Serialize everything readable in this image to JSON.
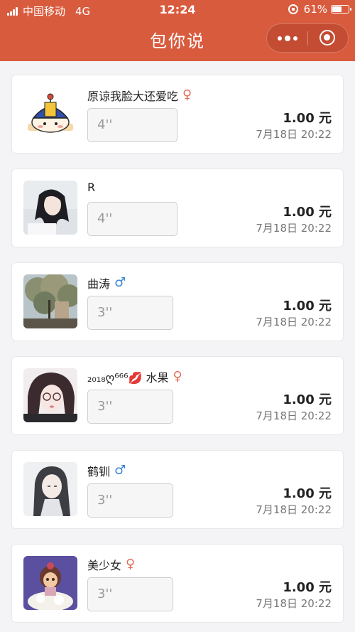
{
  "status_bar": {
    "carrier": "中国移动",
    "network": "4G",
    "time": "12:24",
    "battery": "61%",
    "battery_level": 0.61
  },
  "nav": {
    "title": "包你说"
  },
  "colors": {
    "header_bg": "#d95b3e",
    "female": "#e36e59",
    "male": "#3a87d9"
  },
  "items": [
    {
      "nickname": "原谅我脸大还爱吃",
      "gender": "♀",
      "avatar": "cartoon-hat-avatar",
      "voice": "4''",
      "amount": "1.00 元",
      "date": "7月18日 20:22"
    },
    {
      "nickname": "R",
      "gender": "",
      "avatar": "girl-photo-avatar",
      "voice": "4''",
      "amount": "1.00 元",
      "date": "7月18日 20:22"
    },
    {
      "nickname": "曲涛",
      "gender": "♂",
      "avatar": "tree-photo-avatar",
      "voice": "3''",
      "amount": "1.00 元",
      "date": "7月18日 20:22"
    },
    {
      "nickname": "₂₀₁₈ღ⁶⁶⁶💋 水果",
      "gender": "♀",
      "avatar": "girl-selfie-avatar",
      "voice": "3''",
      "amount": "1.00 元",
      "date": "7月18日 20:22"
    },
    {
      "nickname": "鹤钏",
      "gender": "♂",
      "avatar": "anime-portrait-avatar",
      "voice": "3''",
      "amount": "1.00 元",
      "date": "7月18日 20:22"
    },
    {
      "nickname": "美少女",
      "gender": "♀",
      "avatar": "doll-photo-avatar",
      "voice": "3''",
      "amount": "1.00 元",
      "date": "7月18日 20:22"
    }
  ]
}
